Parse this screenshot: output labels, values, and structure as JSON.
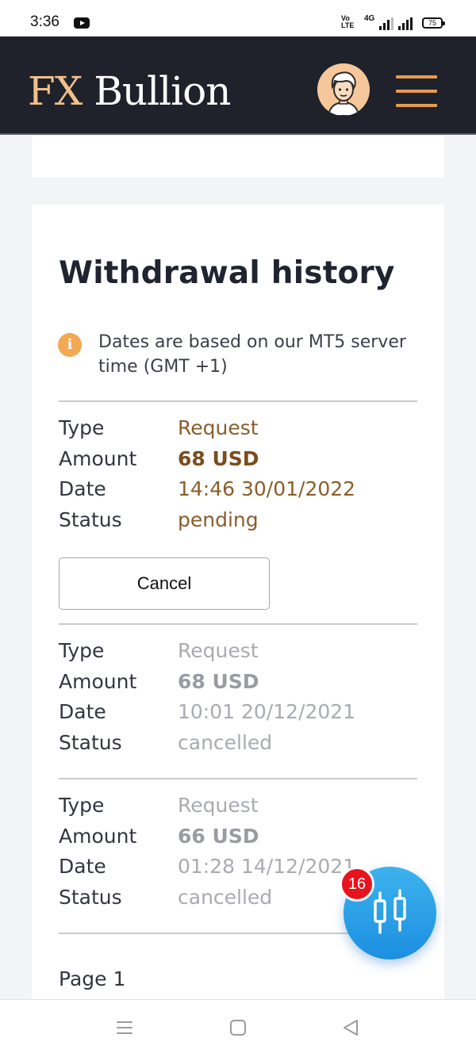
{
  "status_bar": {
    "time": "3:36",
    "network_volte": "Vo\nLTE",
    "network_type": "4G",
    "battery": "75"
  },
  "header": {
    "logo_prefix": "FX",
    "logo_suffix": " Bullion"
  },
  "withdrawal_history": {
    "title": "Withdrawal history",
    "info_note": "Dates are based on our MT5 server time (GMT +1)",
    "labels": {
      "type": "Type",
      "amount": "Amount",
      "date": "Date",
      "status": "Status"
    },
    "entries": [
      {
        "type": "Request",
        "amount": "68 USD",
        "date": "14:46 30/01/2022",
        "status": "pending"
      },
      {
        "type": "Request",
        "amount": "68 USD",
        "date": "10:01 20/12/2021",
        "status": "cancelled"
      },
      {
        "type": "Request",
        "amount": "66 USD",
        "date": "01:28 14/12/2021",
        "status": "cancelled"
      }
    ],
    "cancel_label": "Cancel",
    "page_label": "Page 1"
  },
  "fab": {
    "badge_count": "16",
    "icon": "candlestick-chart-icon"
  },
  "colors": {
    "header_bg": "#1f222b",
    "accent_orange": "#e79a4c",
    "pending_brown": "#8a5d2b",
    "fab_blue": "#1c8fe0",
    "badge_red": "#e8141d"
  }
}
